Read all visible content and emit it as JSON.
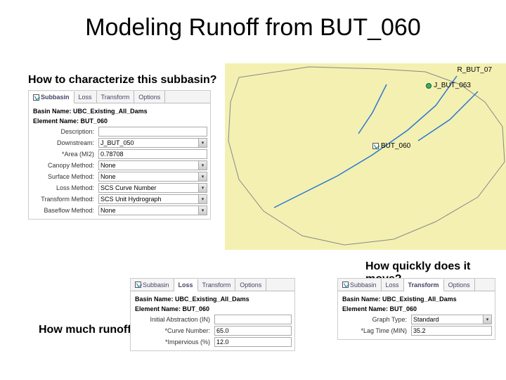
{
  "title": "Modeling Runoff from BUT_060",
  "questions": {
    "q1": "How to characterize this subbasin?",
    "q2": "How quickly does it move?",
    "q3": "How much runoff?"
  },
  "map": {
    "r_label": "R_BUT_07",
    "j_label": "J_BUT_063",
    "sub_label": "BUT_060"
  },
  "panel1": {
    "tabs": {
      "t0": "Subbasin",
      "t1": "Loss",
      "t2": "Transform",
      "t3": "Options"
    },
    "basin_name_label": "Basin Name:",
    "basin_name": "UBC_Existing_All_Dams",
    "element_name_label": "Element Name:",
    "element_name": "BUT_060",
    "rows": {
      "description": {
        "label": "Description:",
        "value": ""
      },
      "downstream": {
        "label": "Downstream:",
        "value": "J_BUT_050"
      },
      "area": {
        "label": "*Area (MI2)",
        "value": "0.78708"
      },
      "canopy": {
        "label": "Canopy Method:",
        "value": "None"
      },
      "surface": {
        "label": "Surface Method:",
        "value": "None"
      },
      "loss": {
        "label": "Loss Method:",
        "value": "SCS Curve Number"
      },
      "transform": {
        "label": "Transform Method:",
        "value": "SCS Unit Hydrograph"
      },
      "baseflow": {
        "label": "Baseflow Method:",
        "value": "None"
      }
    }
  },
  "panel2": {
    "tabs": {
      "t0": "Subbasin",
      "t1": "Loss",
      "t2": "Transform",
      "t3": "Options"
    },
    "basin_name_label": "Basin Name:",
    "basin_name": "UBC_Existing_All_Dams",
    "element_name_label": "Element Name:",
    "element_name": "BUT_060",
    "rows": {
      "ia": {
        "label": "Initial Abstraction (IN)",
        "value": ""
      },
      "cn": {
        "label": "*Curve Number:",
        "value": "65.0"
      },
      "imp": {
        "label": "*Impervious (%)",
        "value": "12.0"
      }
    }
  },
  "panel3": {
    "tabs": {
      "t0": "Subbasin",
      "t1": "Loss",
      "t2": "Transform",
      "t3": "Options"
    },
    "basin_name_label": "Basin Name:",
    "basin_name": "UBC_Existing_All_Dams",
    "element_name_label": "Element Name:",
    "element_name": "BUT_060",
    "rows": {
      "graph": {
        "label": "Graph Type:",
        "value": "Standard"
      },
      "lag": {
        "label": "*Lag Time (MIN)",
        "value": "35.2"
      }
    }
  }
}
